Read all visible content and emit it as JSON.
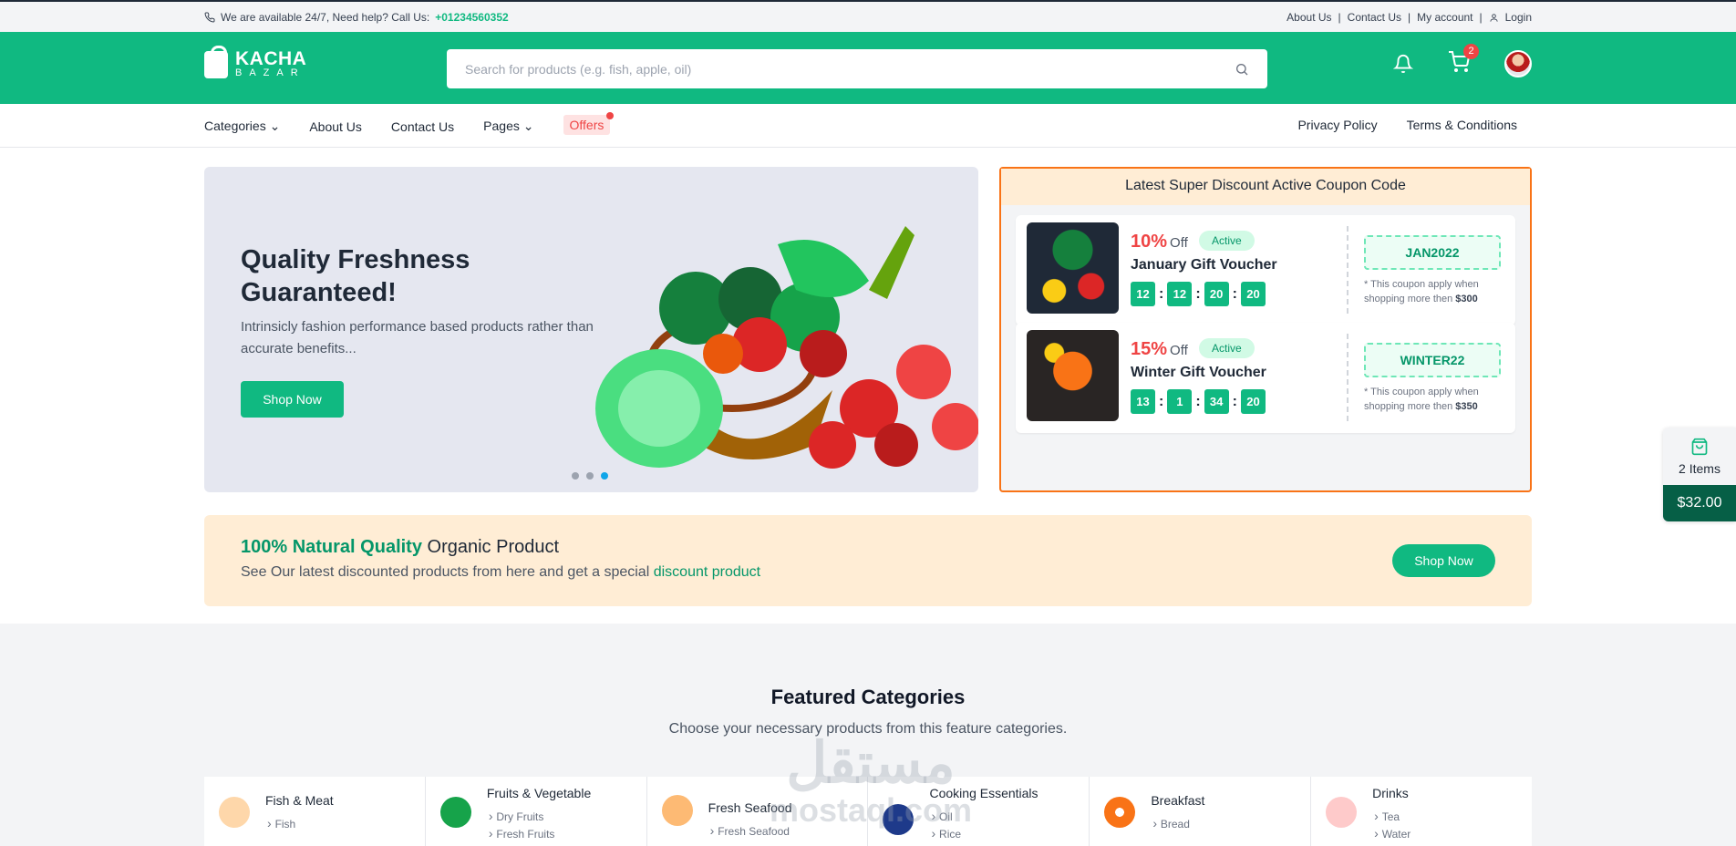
{
  "topbar": {
    "help_text": "We are available 24/7, Need help? Call Us:",
    "phone": "+01234560352",
    "links": [
      "About Us",
      "Contact Us",
      "My account",
      "Login"
    ],
    "separator": "|"
  },
  "header": {
    "logo_line1": "KACHA",
    "logo_line2": "BAZAR",
    "search_placeholder": "Search for products (e.g. fish, apple, oil)",
    "cart_count": "2"
  },
  "nav": {
    "categories": "Categories",
    "about": "About Us",
    "contact": "Contact Us",
    "pages": "Pages",
    "offers": "Offers",
    "privacy": "Privacy Policy",
    "terms": "Terms & Conditions"
  },
  "hero": {
    "title": "Quality Freshness Guaranteed!",
    "description": "Intrinsicly fashion performance based products rather than accurate benefits...",
    "button": "Shop Now",
    "slides": 3,
    "active_slide": 3
  },
  "coupons": {
    "heading": "Latest Super Discount Active Coupon Code",
    "items": [
      {
        "percent": "10%",
        "off": "Off",
        "status": "Active",
        "name": "January Gift Voucher",
        "timer": [
          "12",
          "12",
          "20",
          "20"
        ],
        "code": "JAN2022",
        "note": "* This coupon apply when shopping more then",
        "min": "$300"
      },
      {
        "percent": "15%",
        "off": "Off",
        "status": "Active",
        "name": "Winter Gift Voucher",
        "timer": [
          "13",
          "1",
          "34",
          "20"
        ],
        "code": "WINTER22",
        "note": "* This coupon apply when shopping more then",
        "min": "$350"
      }
    ]
  },
  "promo": {
    "highlight": "100% Natural Quality",
    "title_rest": "Organic Product",
    "text": "See Our latest discounted products from here and get a special",
    "link": "discount product",
    "button": "Shop Now"
  },
  "cart_widget": {
    "items": "2 Items",
    "total": "$32.00"
  },
  "featured": {
    "title": "Featured Categories",
    "subtitle": "Choose your necessary products from this feature categories.",
    "categories": [
      {
        "name": "Fish & Meat",
        "subs": [
          "Fish"
        ],
        "icon": "shrimp-icon",
        "color": "#ea580c"
      },
      {
        "name": "Fruits & Vegetable",
        "subs": [
          "Dry Fruits",
          "Fresh Fruits"
        ],
        "icon": "cabbage-icon",
        "color": "#16a34a"
      },
      {
        "name": "Fresh Seafood",
        "subs": [
          "Fresh Seafood"
        ],
        "icon": "prawn-icon",
        "color": "#f97316"
      },
      {
        "name": "Cooking Essentials",
        "subs": [
          "Oil",
          "Rice"
        ],
        "icon": "pan-icon",
        "color": "#1e3a8a"
      },
      {
        "name": "Breakfast",
        "subs": [
          "Bread"
        ],
        "icon": "donut-icon",
        "color": "#f97316"
      },
      {
        "name": "Drinks",
        "subs": [
          "Tea",
          "Water"
        ],
        "icon": "juice-icon",
        "color": "#ef4444"
      }
    ]
  },
  "watermark": {
    "line1": "مستقل",
    "line2": "mostaql.com"
  },
  "colors": {
    "primary": "#10b981",
    "accent": "#ef4444",
    "promo_bg": "#ffedd5",
    "coupon_border": "#f97316"
  }
}
